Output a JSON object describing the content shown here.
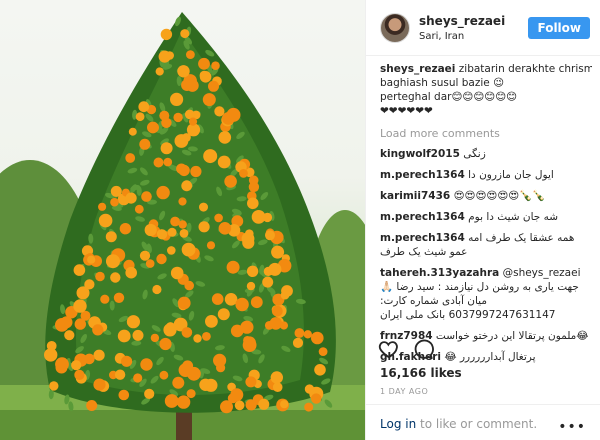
{
  "post": {
    "username": "sheys_rezaei",
    "location": "Sari, Iran",
    "follow_label": "Follow",
    "caption_lines": [
      "zibatarin derakhte chrismas 🎄",
      "baghiash susul bazie 😉",
      "perteghal dar😊😊😊😊😊😊",
      "❤❤❤❤❤❤"
    ],
    "load_more_label": "Load more comments",
    "comments": [
      {
        "user": "kingwolf2015",
        "text": "زنگی"
      },
      {
        "user": "m.perech1364",
        "text": "ایول جان مازرون دا"
      },
      {
        "user": "karimii7436",
        "text": "😍😍😍😍😍😍🍾🍾"
      },
      {
        "user": "m.perech1364",
        "text": "شه جان شیث دا بوم"
      },
      {
        "user": "m.perech1364",
        "text": "همه عشقا یک طرف امه عمو شیث یک طرف"
      },
      {
        "user": "tahereh.313yazahra",
        "text": "@sheys_rezaei 🙏🏻 جهت یاری به روشن دل نیازمند : سید رضا میان آبادی شماره کارت: 6037997247631147 بانک ملی ایران"
      },
      {
        "user": "frnz7984",
        "text": "😂ملمون پرتقالا این درختو خواست"
      },
      {
        "user": "gh.fakheri",
        "text": "پرتغال آبدارررررر 😂"
      }
    ],
    "likes": "16,166 likes",
    "time_ago": "1 DAY AGO",
    "footer": {
      "login_label": "Log in",
      "rest": "to like or comment."
    },
    "icons": {
      "like": "heart-icon",
      "comment": "comment-icon",
      "more": "more-options-icon"
    },
    "colors": {
      "follow_bg": "#3897f0",
      "muted": "#999999"
    }
  }
}
